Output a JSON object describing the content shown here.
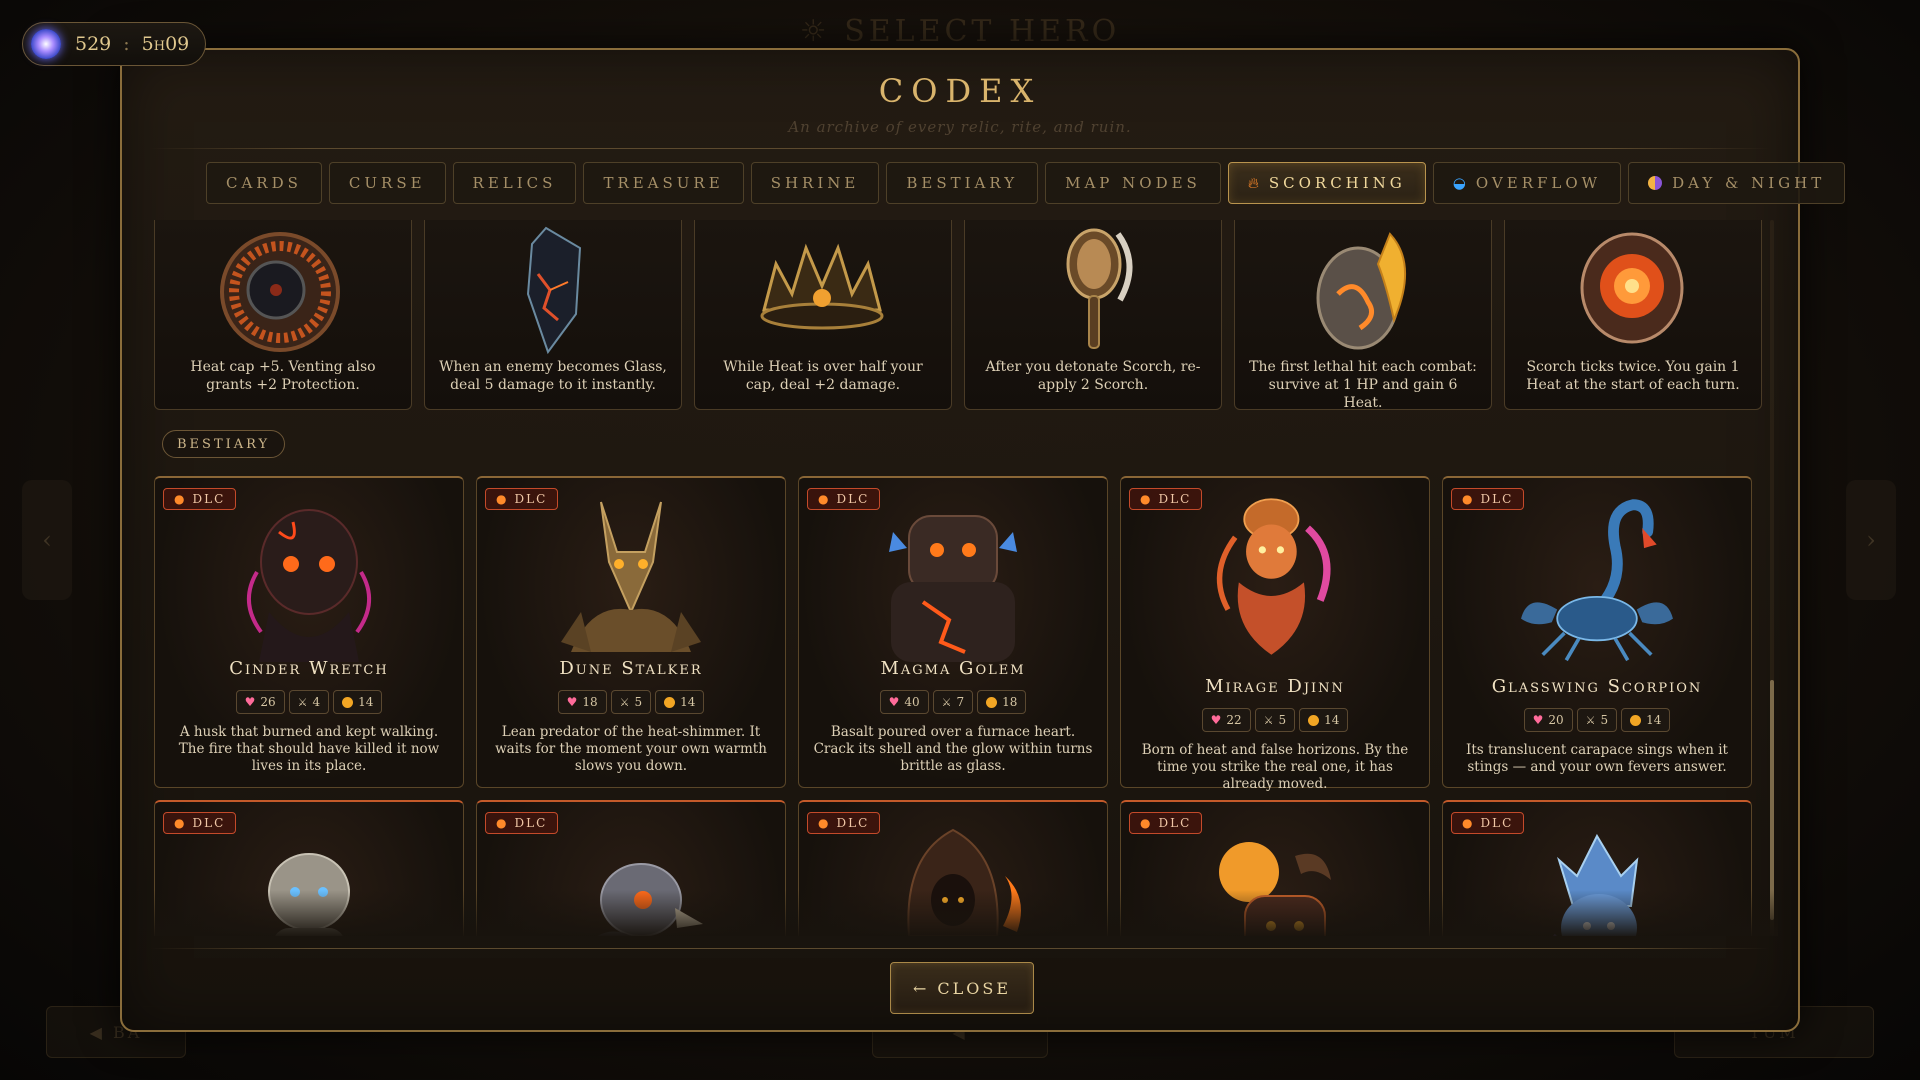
{
  "background": {
    "title": "☼ SELECT HERO",
    "left_button": "◀ BA",
    "center_button": "◀",
    "right_button": "TUM",
    "arrow_left": "‹",
    "arrow_right": "›"
  },
  "currency": {
    "icon": "star-gem-icon",
    "amount": "529",
    "separator": ":",
    "timer": "5h09"
  },
  "codex": {
    "title": "CODEX",
    "subtitle": "An archive of every relic, rite, and ruin.",
    "tabs": [
      {
        "label": "CARDS",
        "active": false
      },
      {
        "label": "CURSE",
        "active": false
      },
      {
        "label": "RELICS",
        "active": false
      },
      {
        "label": "TREASURE",
        "active": false
      },
      {
        "label": "SHRINE",
        "active": false
      },
      {
        "label": "BESTIARY",
        "active": false
      },
      {
        "label": "MAP NODES",
        "active": false
      },
      {
        "label": "SCORCHING",
        "active": true,
        "icon": "flame-icon"
      },
      {
        "label": "OVERFLOW",
        "active": false,
        "icon": "wave-icon"
      },
      {
        "label": "DAY & NIGHT",
        "active": false,
        "icon": "day-night-icon"
      }
    ],
    "relics": [
      {
        "icon": "vent-shield-icon",
        "text": "Heat cap +5. Venting also grants +2 Protection."
      },
      {
        "icon": "glass-shard-icon",
        "text": "When an enemy becomes Glass, deal 5 damage to it instantly."
      },
      {
        "icon": "ember-crown-icon",
        "text": "While Heat is over half your cap, deal +2 damage."
      },
      {
        "icon": "hand-mirror-icon",
        "text": "After you detonate Scorch, re-apply 2 Scorch."
      },
      {
        "icon": "phoenix-egg-icon",
        "text": "The first lethal hit each combat: survive at 1 HP and gain 6 Heat."
      },
      {
        "icon": "ember-core-icon",
        "text": "Scorch ticks twice. You gain 1 Heat at the start of each turn."
      }
    ],
    "bestiary_label": "BESTIARY",
    "dlc_label": "DLC",
    "beasts": [
      {
        "name": "Cinder Wretch",
        "hp": "26",
        "atk": "4",
        "gold": "14",
        "desc": "A husk that burned and kept walking. The fire that should have killed it now lives in its place.",
        "icon": "cinder-wretch-icon"
      },
      {
        "name": "Dune Stalker",
        "hp": "18",
        "atk": "5",
        "gold": "14",
        "desc": "Lean predator of the heat-shimmer. It waits for the moment your own warmth slows you down.",
        "icon": "dune-stalker-icon"
      },
      {
        "name": "Magma Golem",
        "hp": "40",
        "atk": "7",
        "gold": "18",
        "desc": "Basalt poured over a furnace heart. Crack its shell and the glow within turns brittle as glass.",
        "icon": "magma-golem-icon"
      },
      {
        "name": "Mirage Djinn",
        "hp": "22",
        "atk": "5",
        "gold": "14",
        "desc": "Born of heat and false horizons. By the time you strike the real one, it has already moved.",
        "icon": "mirage-djinn-icon"
      },
      {
        "name": "Glasswing Scorpion",
        "hp": "20",
        "atk": "5",
        "gold": "14",
        "desc": "Its translucent carapace sings when it stings — and your own fevers answer.",
        "icon": "glasswing-scorpion-icon"
      }
    ],
    "beasts_row2": [
      {
        "icon": "stone-imp-icon"
      },
      {
        "icon": "ash-vulture-icon"
      },
      {
        "icon": "hooded-pyromancer-icon"
      },
      {
        "icon": "sun-horned-demon-icon"
      },
      {
        "icon": "crystal-sprite-icon"
      }
    ],
    "close_label": "← CLOSE"
  },
  "colors": {
    "accent_gold": "#d9b46c",
    "dlc_red": "#c44a2a",
    "heart": "#ff6b9a",
    "coin": "#f2a624"
  }
}
